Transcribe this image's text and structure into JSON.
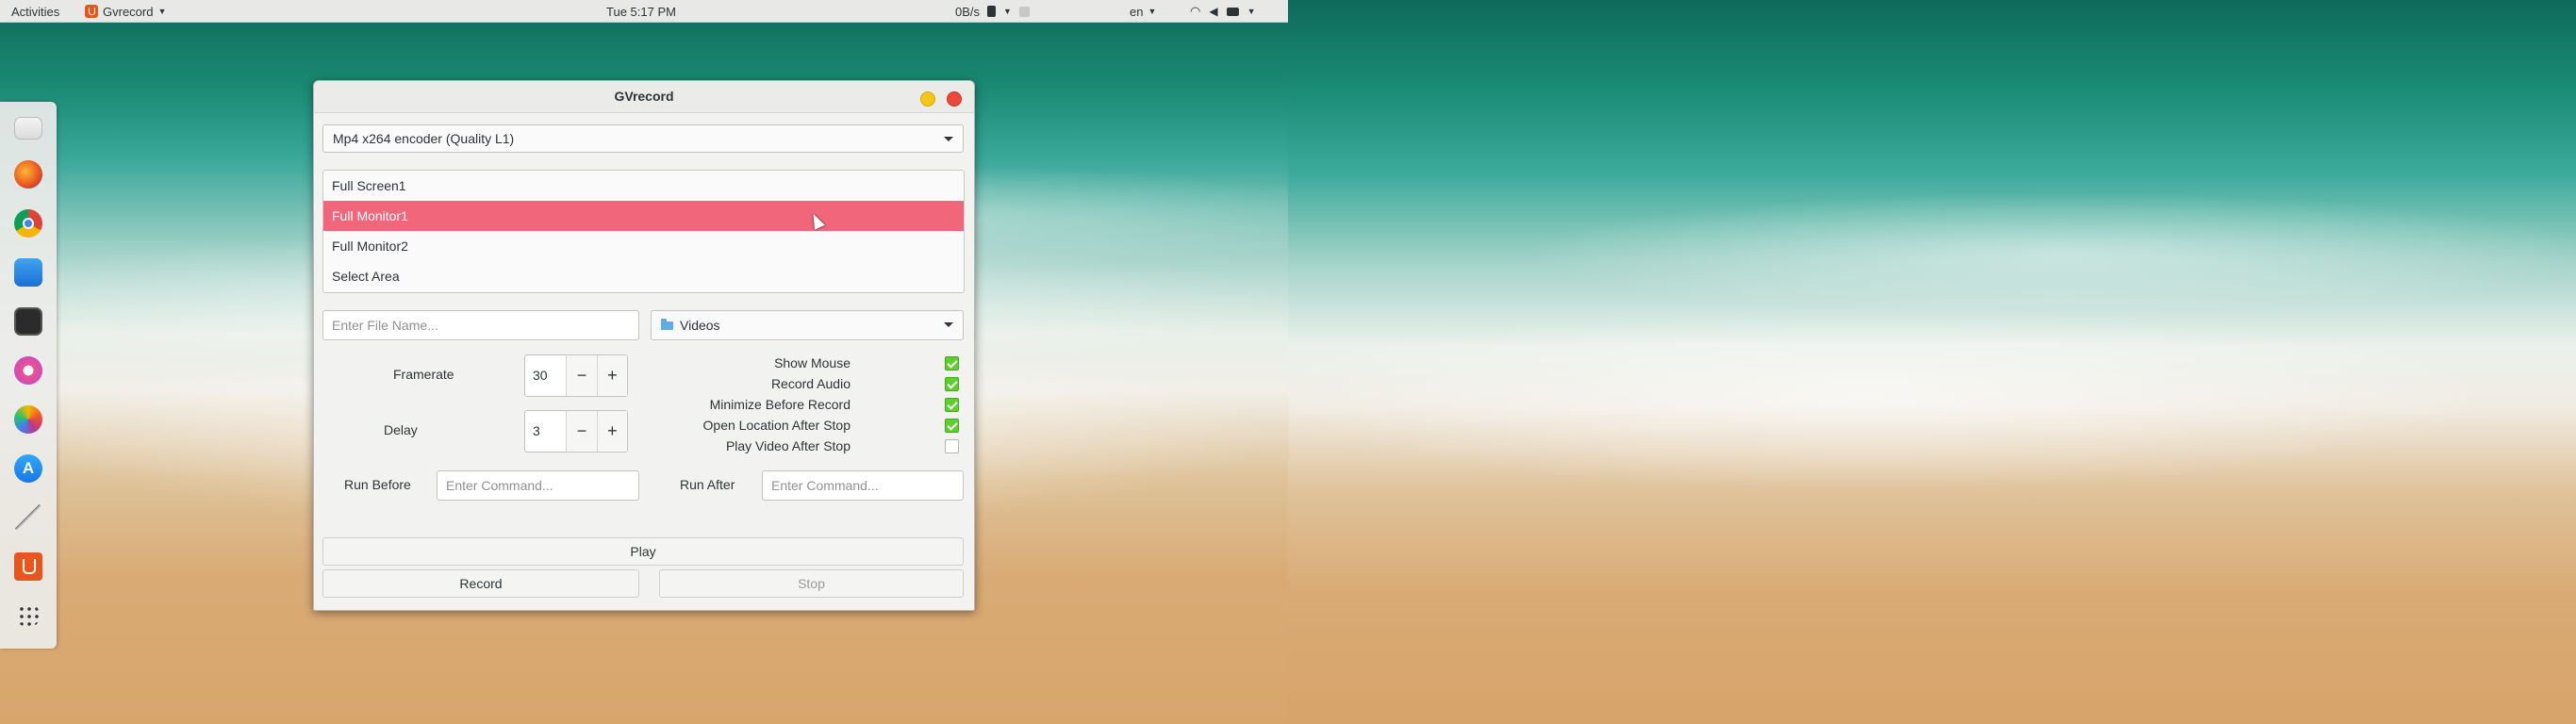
{
  "topbar": {
    "activities": "Activities",
    "app_menu": "Gvrecord",
    "clock": "Tue  5:17 PM",
    "net_speed": "0B/s",
    "language": "en"
  },
  "dock": {
    "items": [
      "files-icon",
      "firefox-icon",
      "chrome-icon",
      "finder-icon",
      "terminal-icon",
      "music-icon",
      "photos-icon",
      "app-store-icon",
      "text-editor-icon",
      "gvrecord-icon",
      "app-grid-icon"
    ]
  },
  "window": {
    "title": "GVrecord",
    "encoder": {
      "selected": "Mp4 x264 encoder (Quality L1)"
    },
    "sources": [
      {
        "label": "Full Screen1",
        "selected": false
      },
      {
        "label": "Full Monitor1",
        "selected": true
      },
      {
        "label": "Full Monitor2",
        "selected": false
      },
      {
        "label": "Select Area",
        "selected": false
      }
    ],
    "filename": {
      "placeholder": "Enter File Name...",
      "value": ""
    },
    "folder": {
      "selected": "Videos"
    },
    "framerate": {
      "label": "Framerate",
      "value": "30"
    },
    "delay": {
      "label": "Delay",
      "value": "3"
    },
    "options": [
      {
        "label": "Show Mouse",
        "checked": true
      },
      {
        "label": "Record Audio",
        "checked": true
      },
      {
        "label": "Minimize Before Record",
        "checked": true
      },
      {
        "label": "Open Location After Stop",
        "checked": true
      },
      {
        "label": "Play Video After Stop",
        "checked": false
      }
    ],
    "run_before": {
      "label": "Run Before",
      "placeholder": "Enter Command..."
    },
    "run_after": {
      "label": "Run After",
      "placeholder": "Enter Command..."
    },
    "buttons": {
      "play": "Play",
      "record": "Record",
      "stop": "Stop"
    },
    "spin_minus": "−",
    "spin_plus": "+"
  },
  "colors": {
    "selection": "#f1667a",
    "check": "#5fcf2f",
    "close": "#ee4a3c",
    "minimize": "#f4c619"
  }
}
